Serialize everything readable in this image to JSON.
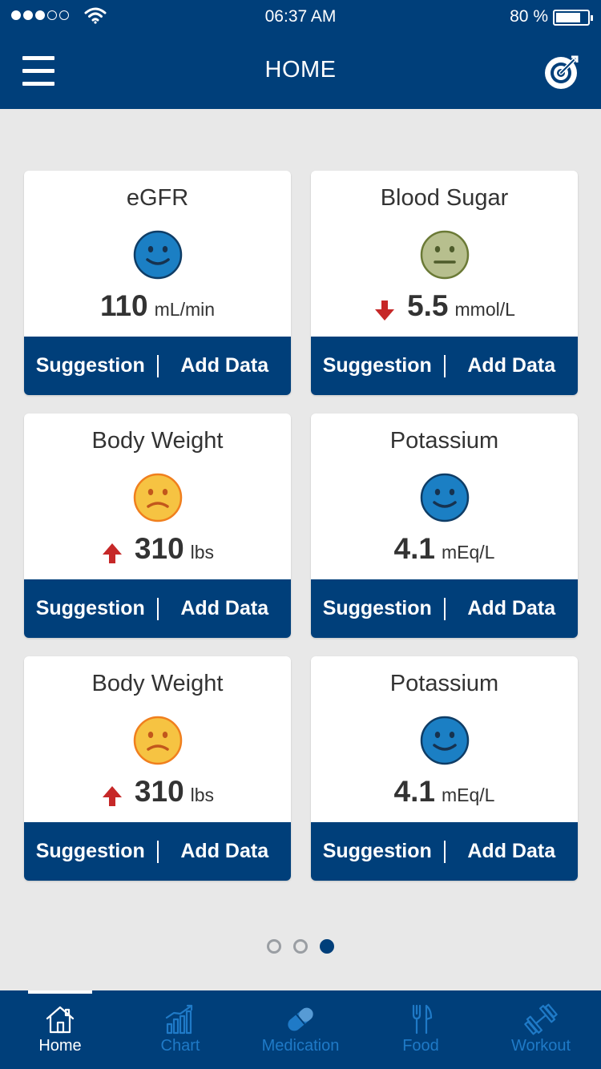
{
  "status_bar": {
    "time": "06:37 AM",
    "battery_percent": "80 %",
    "battery_level": 0.8,
    "signal_bars_filled": 3,
    "signal_bars_total": 5
  },
  "header": {
    "title": "HOME"
  },
  "cards": [
    {
      "title": "eGFR",
      "face": "happy-face-icon",
      "face_color": "#1b7fc4",
      "trend": "none",
      "value": "110",
      "unit": "mL/min",
      "suggestion_label": "Suggestion",
      "add_label": "Add Data"
    },
    {
      "title": "Blood Sugar",
      "face": "neutral-face-icon",
      "face_color": "#b7bf8e",
      "trend": "down",
      "value": "5.5",
      "unit": "mmol/L",
      "suggestion_label": "Suggestion",
      "add_label": "Add Data"
    },
    {
      "title": "Body Weight",
      "face": "sad-face-icon",
      "face_color": "#f6c342",
      "trend": "up",
      "value": "310",
      "unit": "lbs",
      "suggestion_label": "Suggestion",
      "add_label": "Add Data"
    },
    {
      "title": "Potassium",
      "face": "happy-face-icon",
      "face_color": "#1b7fc4",
      "trend": "none",
      "value": "4.1",
      "unit": "mEq/L",
      "suggestion_label": "Suggestion",
      "add_label": "Add Data"
    },
    {
      "title": "Body Weight",
      "face": "sad-face-icon",
      "face_color": "#f6c342",
      "trend": "up",
      "value": "310",
      "unit": "lbs",
      "suggestion_label": "Suggestion",
      "add_label": "Add Data"
    },
    {
      "title": "Potassium",
      "face": "happy-face-icon",
      "face_color": "#1b7fc4",
      "trend": "none",
      "value": "4.1",
      "unit": "mEq/L",
      "suggestion_label": "Suggestion",
      "add_label": "Add Data"
    }
  ],
  "pager": {
    "pages": 3,
    "active_index": 2
  },
  "tabs": [
    {
      "label": "Home",
      "icon": "home-icon",
      "active": true
    },
    {
      "label": "Chart",
      "icon": "chart-icon",
      "active": false
    },
    {
      "label": "Medication",
      "icon": "pill-icon",
      "active": false
    },
    {
      "label": "Food",
      "icon": "fork-knife-icon",
      "active": false
    },
    {
      "label": "Workout",
      "icon": "dumbbell-icon",
      "active": false
    }
  ],
  "colors": {
    "primary": "#003f7a",
    "tab_inactive": "#1f7ac7",
    "trend_arrow": "#c62828",
    "background": "#e8e8e8"
  }
}
